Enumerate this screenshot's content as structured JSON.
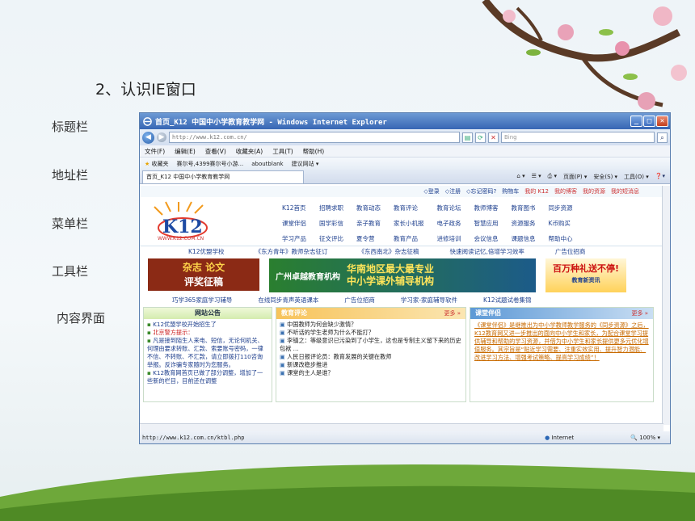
{
  "slide": {
    "title": "2、认识IE窗口",
    "labels": [
      "标题栏",
      "地址栏",
      "菜单栏",
      "工具栏",
      "内容界面"
    ]
  },
  "window": {
    "title": "首页_K12 中国中小学教育教学网 - Windows Internet Explorer",
    "controls": [
      "_",
      "□",
      "✕"
    ],
    "address": "http://www.k12.com.cn/",
    "search_placeholder": "Bing",
    "menu": [
      "文件(F)",
      "编辑(E)",
      "查看(V)",
      "收藏夹(A)",
      "工具(T)",
      "帮助(H)"
    ],
    "favorites": [
      "收藏夹",
      "赛尔号,4399赛尔号小游...",
      "aboutblank",
      "建议网站 ▾"
    ],
    "tab_title": "首页_K12 中国中小学教育教学网",
    "tab_tools": [
      "页面(P) ▾",
      "安全(S) ▾",
      "工具(O) ▾"
    ],
    "status_url": "http://www.k12.com.cn/ktbl.php",
    "status_zone": "Internet",
    "zoom": "100%"
  },
  "site": {
    "toplinks": [
      "◇登录",
      "◇注册",
      "◇忘记密码?",
      "购物车",
      "我的 K12",
      "我的博客",
      "我的资源",
      "我的短消息"
    ],
    "logo": "K12",
    "logo_url": "WWW.K12.COM.CN",
    "nav": [
      "K12首页",
      "招聘求职",
      "教育动态",
      "教育评论",
      "教育论坛",
      "教师博客",
      "教育图书",
      "同步资源",
      "课堂伴侣",
      "国学彩信",
      "亲子教育",
      "家长小机报",
      "电子政务",
      "智慧应用",
      "资源服务",
      "K币购买",
      "学习产品",
      "征文评比",
      "夏令营",
      "教育产品",
      "进修培训",
      "会议信息",
      "课题信息",
      "帮助中心"
    ],
    "row1": [
      "K12优盟学校",
      "《东方青年》教师杂志征订",
      "《东西南北》杂志征稿",
      "快速阅读记忆,倍增学习效率",
      "广告位招商"
    ],
    "banner1": [
      "杂志 论文",
      "评奖征稿"
    ],
    "banner2_org": "广州卓越教育机构",
    "banner2_slogan": [
      "华南地区最大最专业",
      "中小学课外辅导机构"
    ],
    "banner3": [
      "百万种礼送不停!",
      "教育新资讯"
    ],
    "row2": [
      "巧学365家庭学习辅导",
      "在线同步青声英语课本",
      "广告位招商",
      "学习家-家庭辅导软件",
      "K12试题试卷集锦"
    ],
    "panel1": {
      "title": "网站公告",
      "items": [
        "K12优盟学校开始招生了",
        "北京警方提示：",
        "凡是接到陌生人来电、短信，无论何机关、何理由要求转账、汇款、索要账号密码，一律不信、不转账、不汇款，请立即拨打110咨询举报。反诈骗专家随时为您服务。",
        "K12教育网首页已做了部分调整，增加了一些新的栏目，目前还在调整"
      ]
    },
    "panel2": {
      "title": "教育评论",
      "more": "更多 »",
      "items": [
        "中国教师为何会缺少激情？",
        "不听话的学生老师为什么不能打？",
        "李镇之：等级意识已污染到了小学生，这也是专制主义留下来的历史包袱 ...",
        "人民日报评论员：教育发展的关键在教师",
        "新课改稳步推进",
        "课堂的主人是谁？"
      ]
    },
    "panel3": {
      "title": "课堂伴侣",
      "more": "更多 »",
      "text": "《课堂伴侣》是继推出为中小学教师教学服务的《同步资源》之后，K12教育网又进一步推出的面向中小学生和家长，为配合课堂学习提供辅导和帮助的学习资源，并借为中小学生和家长提供更多元优化增值服务。其宗旨是“贴近学习需要、注重实效实用、提升智力潜能、改进学习方法、增强考试策略、提高学习成绩”！"
    }
  },
  "colors": {
    "titlebar": "#3766b4",
    "accent": "#1d3f8e"
  }
}
